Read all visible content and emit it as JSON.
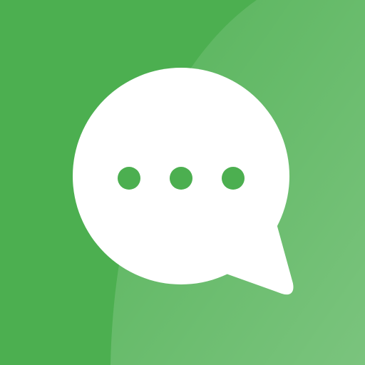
{
  "app_icon": {
    "icon": "chat-bubble-icon",
    "dots_icon": "ellipsis-icon",
    "colors": {
      "background": "#4CAF50",
      "highlight": "#81C784",
      "bubble": "#FFFFFF",
      "dots": "#4CAF50"
    }
  }
}
